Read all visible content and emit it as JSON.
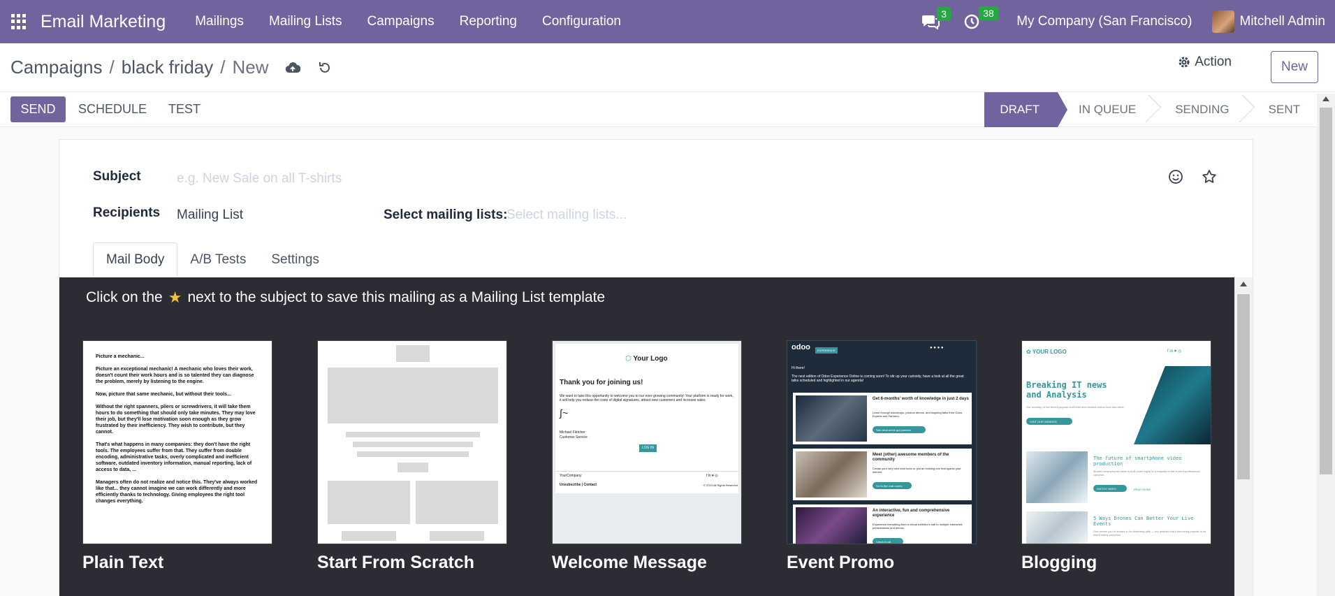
{
  "nav": {
    "app_name": "Email Marketing",
    "menu": [
      "Mailings",
      "Mailing Lists",
      "Campaigns",
      "Reporting",
      "Configuration"
    ],
    "messages_count": "3",
    "activities_count": "38",
    "company": "My Company (San Francisco)",
    "user": "Mitchell Admin"
  },
  "breadcrumb": {
    "root": "Campaigns",
    "parent": "black friday",
    "current": "New"
  },
  "control": {
    "action_label": "Action",
    "new_label": "New"
  },
  "buttons": {
    "send": "SEND",
    "schedule": "SCHEDULE",
    "test": "TEST"
  },
  "stages": [
    "DRAFT",
    "IN QUEUE",
    "SENDING",
    "SENT"
  ],
  "form": {
    "subject_label": "Subject",
    "subject_placeholder": "e.g. New Sale on all T-shirts",
    "recipients_label": "Recipients",
    "recipients_value": "Mailing List",
    "mailing_lists_label": "Select mailing lists:",
    "mailing_lists_placeholder": "Select mailing lists..."
  },
  "tabs": [
    "Mail Body",
    "A/B Tests",
    "Settings"
  ],
  "hint": {
    "before": "Click on the",
    "after": "next to the subject to save this mailing as a Mailing List template"
  },
  "templates": [
    "Plain Text",
    "Start From Scratch",
    "Welcome Message",
    "Event Promo",
    "Blogging"
  ],
  "thumbs": {
    "plain_text": [
      "Picture a mechanic...",
      "Picture an exceptional mechanic! A mechanic who loves their work, doesn't count their work hours and is so talented they can diagnose the problem, merely by listening to the engine.",
      "Now, picture that same mechanic, but without their tools...",
      "Without the right spanners, pliers or screwdrivers, it will take them hours to do something that should only take minutes. They may love their job, but they'll lose motivation soon enough as they grow frustrated by their inefficiency. They wish to contribute, but they cannot.",
      "That's what happens in many companies: they don't have the right tools. The employees suffer from that. They suffer from double encoding, administrative tasks, overly complicated and inefficient software, outdated inventory information, manual reporting, lack of access to data, ...",
      "Managers often do not realize and notice this. They've always worked like that... they cannot imagine we can work differently and more efficiently thanks to technology. Giving employees the right tool changes everything."
    ],
    "welcome": {
      "logo": "Your Logo",
      "heading": "Thank you for joining us!",
      "body": "We want to take this opportunity to welcome you to our ever-growing community! Your platform is ready for work, it will help you reduce the costs of digital signatures, attract new customers and increase sales.",
      "signer": "Michael Fletcher",
      "signer_role": "Customer Service",
      "button": "LOG IN",
      "footer_company": "YourCompany",
      "footer_links": "Unsubscribe | Contact",
      "rights": "© 2023 All Rights Reserved"
    },
    "event": {
      "brand": "odoo",
      "tag": "EXPERIENCE",
      "greeting": "Hi there!",
      "intro": "The next edition of Odoo Experience Online is coming soon! To stir up your curiosity, have a look at all the great talks scheduled and highlighted in our agenda!",
      "card1_title": "Get 6-months' worth of knowledge in just 2 days",
      "card1_text": "Learn through workshops, product demos, and inspiring talks from Odoo Experts and Partners.",
      "card1_btn": "See what we've got planned",
      "card2_title": "Meet (other) awesome members of the community",
      "card2_text": "Create your very own chat room or join an existing one that sparks your interest.",
      "card2_btn": "Go to the chat rooms",
      "card3_title": "An interactive, fun and comprehensive experience",
      "card3_text": "Experience everything from a virtual exhibitor's hall to multiple interactive presentations and demos.",
      "card3_btn": "Check it out"
    },
    "blog": {
      "logo": "YOUR LOGO",
      "headline": "Breaking IT news and Analysis",
      "sub": "Our roundup of the recent popular and fresh tech related videos from last week",
      "cta": "VISIT OUR WEBSITE",
      "post1_title": "The future of smartphone video production",
      "post1_text": "Modern smartphones have in-built zoom equal to a majority of the current professional cameras",
      "post1_btn1": "WATCH VIDEO",
      "post1_btn2": "READ MORE",
      "post2_title": "5 Ways Drones Can Better Your Live Events",
      "post2_text": "One dream you of drones is for delivering gifts — but another that's becoming popular is for event safety purposes"
    }
  },
  "colors": {
    "brand": "#71639e",
    "dark_panel": "#2c2c35",
    "badge": "#28a745",
    "teal": "#35979c"
  }
}
